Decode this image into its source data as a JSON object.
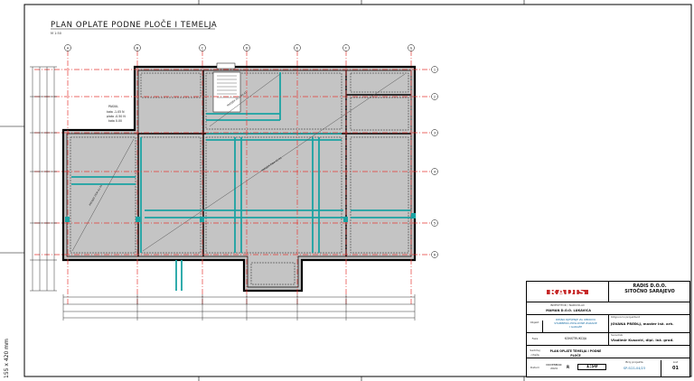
{
  "drawing": {
    "title": "PLAN OPLATE PODNE PLOČE I TEMELJA",
    "scale_note": "M 1:50",
    "grid_letters": [
      "A",
      "B",
      "C",
      "D",
      "E",
      "F",
      "G"
    ],
    "grid_numbers": [
      "1",
      "2",
      "3",
      "4",
      "5",
      "6"
    ],
    "label_pasiul": "PASIUL",
    "label_block": [
      "kota -1.05 N",
      "plato -0.50 N",
      "kota 0.00"
    ],
    "annotation_long": "PRESJEK ZIDA A1-A1",
    "side_text": "155 x 420 mm"
  },
  "titleblock": {
    "logo": "RADIS",
    "company": [
      "RADIS D.O.O.",
      "SITOČNO SARAJEVO"
    ],
    "investor_label": "INVESTITOR / NARUČILAC",
    "investor": "MAMAN D.O.O. LUKAVICA",
    "object_label": "Objekt",
    "object_text": [
      "IDEJNO RJEŠENJE ZA OBNOVU",
      "STAMBENO-POSLOVNE ZGRADE",
      "I GARAŽE"
    ],
    "designer_label": "Odgovorni projektant",
    "designer": "JOVANA PREĐLJ, master inž. arh.",
    "faza_label": "Faza",
    "faza": "KONSTRUKCIJA",
    "saradnik_label": "Saradnik",
    "saradnik": "Vladimir Kusović, dipl. inž. građ.",
    "crtez_label": "Sadržaj crteža",
    "crtez": "PLAN OPLATE TEMELJA I PODNE PLOČE",
    "datum_label": "Datum",
    "datum": "NOVEMBAR 2024",
    "razmjer_label": "R",
    "razmjer": "1:50",
    "broj_label": "Broj projekta",
    "broj": "SP-SCG-04/23",
    "list_label": "List",
    "list": "01"
  }
}
